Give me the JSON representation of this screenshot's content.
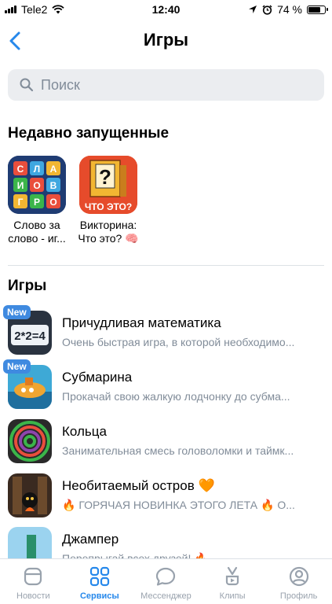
{
  "status_bar": {
    "carrier": "Tele2",
    "time": "12:40",
    "battery_percent": "74 %",
    "battery_level": 0.74
  },
  "header": {
    "title": "Игры"
  },
  "search": {
    "placeholder": "Поиск"
  },
  "recent": {
    "title": "Недавно запущенные",
    "items": [
      {
        "name_line1": "Слово за",
        "name_line2": "слово - иг...",
        "tiles": [
          "С",
          "Л",
          "А",
          "И",
          "О",
          "В",
          "Г",
          "Р",
          "О"
        ]
      },
      {
        "name_line1": "Викторина:",
        "name_line2": "Что это? 🧠",
        "icon_text": "ЧТО ЭТО?",
        "icon_symbol": "?"
      }
    ]
  },
  "games": {
    "title": "Игры",
    "new_label": "New",
    "items": [
      {
        "title": "Причудливая математика",
        "desc": "Очень быстрая игра, в которой необходимо...",
        "icon_text": "2*2=4",
        "is_new": true
      },
      {
        "title": "Субмарина",
        "desc": "Прокачай свою жалкую лодчонку до субма...",
        "is_new": true
      },
      {
        "title": "Кольца",
        "desc": "Занимательная смесь головоломки и таймк...",
        "is_new": false
      },
      {
        "title": "Необитаемый остров 🧡",
        "desc": "🔥 ГОРЯЧАЯ НОВИНКА ЭТОГО ЛЕТА 🔥 О...",
        "is_new": false
      },
      {
        "title": "Джампер",
        "desc": "Перепрыгай всех друзей! 🔥",
        "is_new": false
      }
    ]
  },
  "tabbar": {
    "items": [
      {
        "label": "Новости",
        "icon": "news-icon"
      },
      {
        "label": "Сервисы",
        "icon": "services-icon",
        "active": true
      },
      {
        "label": "Мессенджер",
        "icon": "messenger-icon"
      },
      {
        "label": "Клипы",
        "icon": "clips-icon"
      },
      {
        "label": "Профиль",
        "icon": "profile-icon"
      }
    ]
  },
  "colors": {
    "accent": "#2688eb",
    "badge": "#3f8ae0",
    "secondary_text": "#818c99",
    "search_bg": "#ebedf0"
  }
}
